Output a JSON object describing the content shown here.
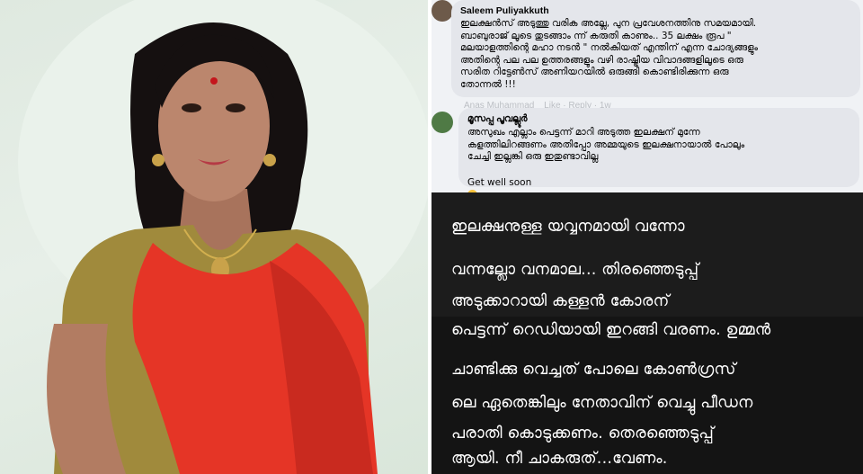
{
  "photo": {
    "alt": "woman-in-red-saree",
    "colors": {
      "saree": "#e53526",
      "blouse": "#a08a3c",
      "hair": "#151010",
      "skin": "#b8826a",
      "background": "#e2ece3"
    }
  },
  "comments": [
    {
      "author": "Saleem Puliyakkuth",
      "text": "ഇലക്ഷൻസ് അടുത്തു വരിക അല്ലേ, പുന പ്രവേശനത്തിനു സമയമായി.\nബാബുരാജ് ലൂടെ തുടങ്ങാം ന്ന് കരുതി കാണും.. 35 ലക്ഷം രൂപ \"\nമലയാളത്തിന്റെ മഹാ നടൻ \" നൽകിയത് എന്തിന് എന്ന ചോദ്യങ്ങളും\nഅതിന്റെ പല പല ഉത്തരങ്ങളും വഴി രാഷ്ട്രീയ വിവാദങ്ങളിലൂടെ ഒരു\nസരിത റിട്ടേൺസ് അണിയറയിൽ ഒരുങ്ങി കൊണ്ടിരിക്കുന്ന ഒരു\nതോന്നൽ !!!"
    },
    {
      "author": "മൂസപ്പ പൂവല്ലൂർ",
      "text": "അസുഖം എല്ലാം പെട്ടന്ന് മാറി അടുത്ത ഇലക്ഷന് മുന്നേ\nകളത്തിലിറങ്ങണം അതിപ്പോ അമ്മയുടെ ഇലക്ഷനായാൽ പോലും\nചേച്ചി ഇല്ലങ്കി ഒരു ഇതുണ്ടാവില്ല",
      "extra": "Get well soon",
      "emoji": "smiling-face-icon"
    }
  ],
  "faded_lines": [
    "Anas Muhammad",
    "Like · Reply · 1w"
  ],
  "dark_lines": [
    "ഇലക്ഷനുള്ള യവ്വനമായി വന്നോ",
    "വന്നല്ലോ വനമാല... തിരഞ്ഞെടുപ്പ്",
    "അടുക്കാറായി കള്ളൻ കോരന്",
    "പെട്ടന്ന് റെഡിയായി ഇറങ്ങി വരണം. ഉമ്മൻ",
    "ചാണ്ടിക്കു വെച്ചത് പോലെ കോൺഗ്രസ്",
    "ലെ ഏതെങ്കിലും നേതാവിന് വെച്ചു പീഡന",
    "പരാതി കൊടുക്കണം. തെരഞ്ഞെടുപ്പ്",
    "ആയി. നീ ചാകരുത്...വേണം."
  ]
}
